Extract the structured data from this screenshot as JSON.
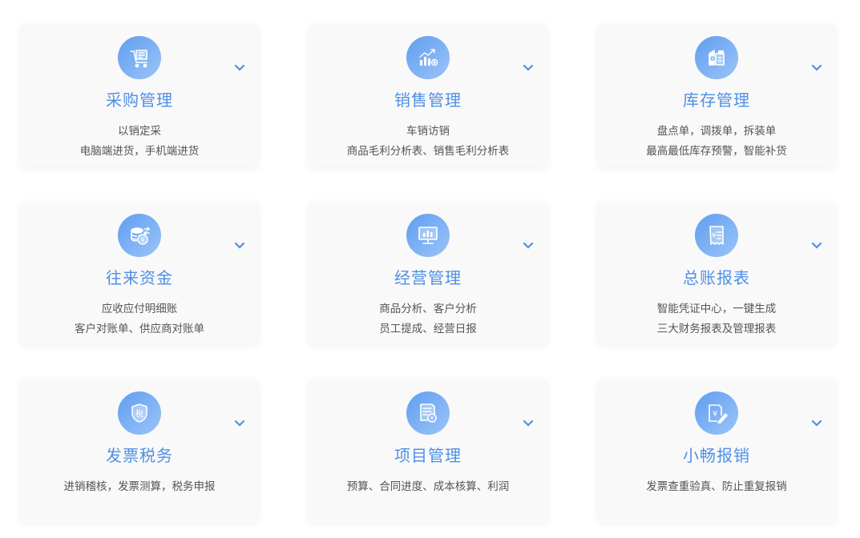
{
  "cards": [
    {
      "icon": "purchase-cart-icon",
      "title": "采购管理",
      "lines": [
        "以销定采",
        "电脑端进货，手机端进货"
      ]
    },
    {
      "icon": "sales-chart-icon",
      "title": "销售管理",
      "lines": [
        "车销访销",
        "商品毛利分析表、销售毛利分析表"
      ]
    },
    {
      "icon": "inventory-box-icon",
      "title": "库存管理",
      "lines": [
        "盘点单，调拨单，拆装单",
        "最高最低库存预警，智能补货"
      ]
    },
    {
      "icon": "funds-coins-icon",
      "title": "往来资金",
      "lines": [
        "应收应付明细账",
        "客户对账单、供应商对账单"
      ]
    },
    {
      "icon": "operation-monitor-icon",
      "title": "经营管理",
      "lines": [
        "商品分析、客户分析",
        "员工提成、经营日报"
      ]
    },
    {
      "icon": "ledger-report-icon",
      "title": "总账报表",
      "lines": [
        "智能凭证中心，一键生成",
        "三大财务报表及管理报表"
      ]
    },
    {
      "icon": "tax-shield-icon",
      "title": "发票税务",
      "lines": [
        "进销稽核，发票测算，税务申报"
      ]
    },
    {
      "icon": "project-document-icon",
      "title": "项目管理",
      "lines": [
        "预算、合同进度、成本核算、利润"
      ]
    },
    {
      "icon": "reimbursement-pen-icon",
      "title": "小畅报销",
      "lines": [
        "发票查重验真、防止重复报销"
      ]
    }
  ],
  "tax_glyph": "税",
  "yen_glyph": "¥",
  "colors": {
    "accent": "#4f8fe6",
    "card_bg": "#f9f9f9",
    "text": "#555555"
  }
}
